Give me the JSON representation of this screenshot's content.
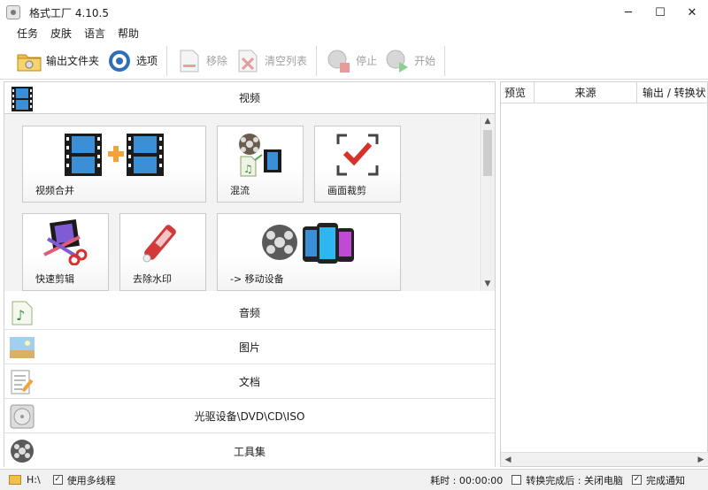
{
  "window": {
    "title": "格式工厂 4.10.5",
    "controls": [
      "─",
      "☐",
      "✕"
    ]
  },
  "menu": [
    "任务",
    "皮肤",
    "语言",
    "帮助"
  ],
  "toolbar": {
    "output_folder": "输出文件夹",
    "options": "选项",
    "remove": "移除",
    "clear_list": "清空列表",
    "stop": "停止",
    "start": "开始"
  },
  "categories": {
    "video": "视频",
    "audio": "音频",
    "image": "图片",
    "document": "文档",
    "disc": "光驱设备\\DVD\\CD\\ISO",
    "tools": "工具集"
  },
  "video_tiles": {
    "merge": "视频合并",
    "mux": "混流",
    "crop": "画面裁剪",
    "quick_cut": "快速剪辑",
    "remove_watermark": "去除水印",
    "to_mobile": "-> 移动设备"
  },
  "task_list": {
    "columns": [
      "预览",
      "来源",
      "输出 / 转换状"
    ]
  },
  "statusbar": {
    "drive": "H:\\",
    "multithread": "使用多线程",
    "multithread_checked": true,
    "elapsed": "耗时 : 00:00:00",
    "after_convert": "转换完成后 : 关闭电脑",
    "after_convert_checked": false,
    "notify": "完成通知",
    "notify_checked": true
  },
  "colors": {
    "film_blue": "#3a8fd6",
    "accent_orange": "#f2a23a",
    "check_red": "#d9302c",
    "statusbar_bg": "#f0f0f0"
  }
}
